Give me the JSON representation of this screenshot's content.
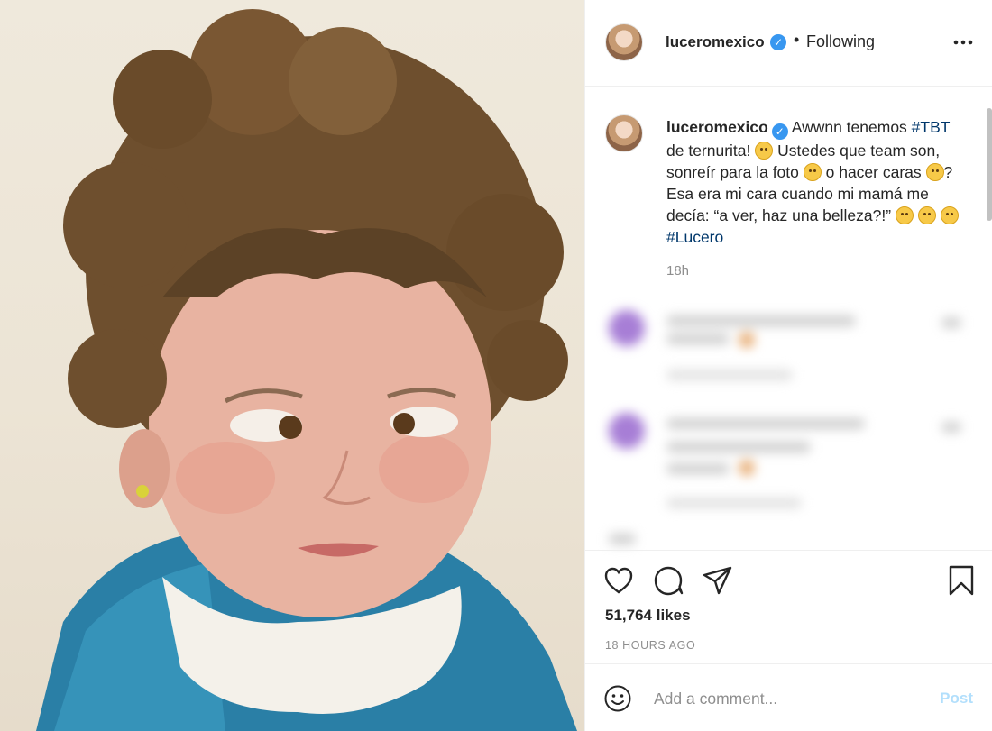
{
  "post": {
    "photo_alt": "",
    "account": {
      "username": "luceromexico",
      "verified": true,
      "follow_status": "Following",
      "separator": "•"
    },
    "caption": {
      "username": "luceromexico",
      "part1": " Awwnn tenemos ",
      "tag_tbt": "#TBT",
      "part2": " de ternurita! ",
      "part3": " Ustedes que team son, sonreír para la foto ",
      "part4": " o hacer caras ",
      "part5": "? Esa era mi cara cuando mi mamá me decía: “a ver, haz una belleza?!” ",
      "tag_lucero": "#Lucero",
      "emojis": [
        "worried-face",
        "grinning-face",
        "zany-face",
        "rolling-laughing-face",
        "face-with-rolling-eyes",
        "rolling-laughing-face"
      ],
      "age": "18h"
    },
    "likes": "51,764 likes",
    "date": "18 HOURS AGO",
    "comment_box": {
      "placeholder": "Add a comment...",
      "post_label": "Post"
    },
    "icons": [
      "heart-icon",
      "comment-icon",
      "share-icon",
      "bookmark-icon",
      "more-icon",
      "emoji-icon"
    ],
    "colors": {
      "verified": "#3897f0",
      "tag": "#00376b",
      "post_disabled": "#b2dffc",
      "muted": "#8e8e8e"
    }
  }
}
